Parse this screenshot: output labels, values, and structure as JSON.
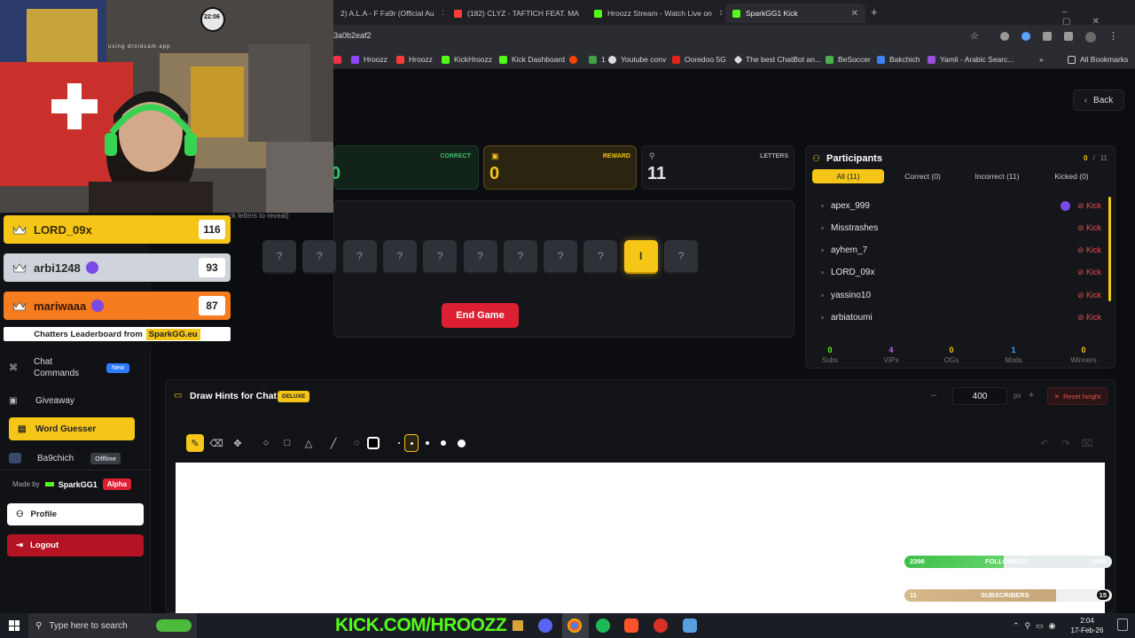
{
  "browser": {
    "tabs": [
      {
        "label": "2) A.L.A - F Fa9r (Official Au",
        "icon_color": "#ff3b3b"
      },
      {
        "label": "(182) CLYZ - TAFTICH FEAT. MA",
        "icon_color": "#ff3b3b"
      },
      {
        "label": "Hroozz Stream - Watch Live on",
        "icon_color": "#53fc18"
      },
      {
        "label": "SparkGG1 Kick",
        "icon_color": "#53fc18"
      }
    ],
    "url": "3a0b2eaf2",
    "bookmarks": [
      {
        "label": "Hroozz",
        "icon_color": "#9147ff"
      },
      {
        "label": "Hroozz",
        "icon_color": "#ff3b3b"
      },
      {
        "label": "KickHroozz",
        "icon_color": "#53fc18"
      },
      {
        "label": "Kick Dashboard",
        "icon_color": "#53fc18"
      },
      {
        "label": "",
        "icon_color": "#ff4500"
      },
      {
        "label": "1",
        "icon_color": "#3ea34a"
      },
      {
        "label": "Youtube conv",
        "icon_color": "#ddd"
      },
      {
        "label": "Ooredoo 5G",
        "icon_color": "#e2231a"
      },
      {
        "label": "The best ChatBot an...",
        "icon_color": "#ddd"
      },
      {
        "label": "BeSoccer",
        "icon_color": "#4caf50"
      },
      {
        "label": "Bakchich",
        "icon_color": "#3b82f6"
      },
      {
        "label": "Yamli - Arabic Searc...",
        "icon_color": "#9c4ee0"
      }
    ],
    "all_bookmarks_label": "All Bookmarks"
  },
  "webcam": {
    "timer": "22:06",
    "watermark": "using droidcam app"
  },
  "leaderboard": {
    "rows": [
      {
        "name": "LORD_09x",
        "score": "116",
        "color": "#f5c518",
        "text_color": "#3a2c00",
        "badge": false
      },
      {
        "name": "arbi1248",
        "score": "93",
        "color": "#cfd3db",
        "text_color": "#2a2a2a",
        "badge": true
      },
      {
        "name": "mariwaaa",
        "score": "87",
        "color": "#f57c1f",
        "text_color": "#3a1800",
        "badge": true
      }
    ],
    "footer_prefix": "Chatters Leaderboard from",
    "footer_brand": "SparkGG.eu"
  },
  "sidebar": {
    "chat_commands": "Chat Commands",
    "new_badge": "New",
    "giveaway": "Giveaway",
    "word_guesser": "Word Guesser",
    "ba9chich": "Ba9chich",
    "offline_badge": "Offline",
    "made_by": "Made by",
    "author": "SparkGG1",
    "alpha_badge": "Alpha",
    "profile": "Profile",
    "logout": "Logout"
  },
  "back_label": "Back",
  "stats": {
    "correct_label": "CORRECT",
    "correct_value": "0",
    "reward_label": "REWARD",
    "reward_value": "0",
    "letters_label": "LETTERS",
    "letters_value": "11"
  },
  "word": {
    "hint": "ck letters to reveal)",
    "letters": [
      "?",
      "?",
      "?",
      "?",
      "?",
      "?",
      "?",
      "?",
      "?",
      "I",
      "?"
    ],
    "revealed_index": 9,
    "end_game": "End Game"
  },
  "participants": {
    "title": "Participants",
    "count_correct": "0",
    "count_sep": "/",
    "count_total": "11",
    "tabs": [
      "All (11)",
      "Correct (0)",
      "Incorrect (11)",
      "Kicked (0)"
    ],
    "list": [
      {
        "name": "apex_999",
        "gem": true
      },
      {
        "name": "Misstrashes",
        "gem": false
      },
      {
        "name": "ayhem_7",
        "gem": false
      },
      {
        "name": "LORD_09x",
        "gem": false
      },
      {
        "name": "yassino10",
        "gem": false
      },
      {
        "name": "arbiatoumi",
        "gem": false
      }
    ],
    "kick_label": "Kick",
    "stats": [
      {
        "value": "0",
        "label": "Subs",
        "color": "#53fc18"
      },
      {
        "value": "4",
        "label": "VIPs",
        "color": "#b067ff"
      },
      {
        "value": "0",
        "label": "OGs",
        "color": "#f5c518"
      },
      {
        "value": "1",
        "label": "Mods",
        "color": "#4aa3ff"
      },
      {
        "value": "0",
        "label": "Winners",
        "color": "#f5c518"
      }
    ]
  },
  "draw": {
    "title": "Draw Hints for Chat",
    "badge": "DELUXE",
    "height_value": "400",
    "unit": "px",
    "reset": "Reset height"
  },
  "overlay": {
    "followers_current": "2398",
    "followers_label": "FOLLOWERS",
    "followers_goal": "5000",
    "followers_progress": 0.48,
    "subs_current": "11",
    "subs_label": "SUBSCRIBERS",
    "subs_goal": "15",
    "subs_progress": 0.73,
    "kick_banner": "KICK.COM/HROOZZ"
  },
  "taskbar": {
    "search_placeholder": "Type here to search",
    "time": "2:04",
    "date": "17-Feb-26"
  }
}
